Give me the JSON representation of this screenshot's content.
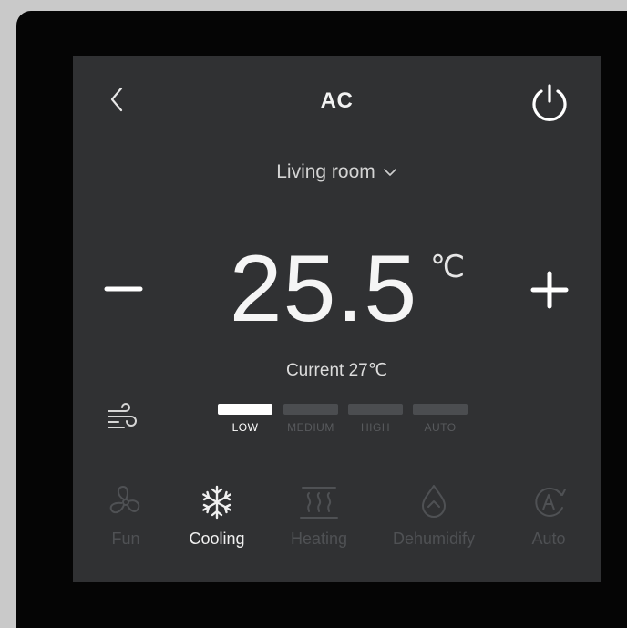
{
  "header": {
    "title": "AC"
  },
  "room": {
    "name": "Living room"
  },
  "temperature": {
    "setpoint": "25.5",
    "unit": "℃",
    "current": "Current 27℃"
  },
  "fan_speed": {
    "selected": "LOW",
    "options": [
      {
        "label": "LOW",
        "active": true
      },
      {
        "label": "MEDIUM",
        "active": false
      },
      {
        "label": "HIGH",
        "active": false
      },
      {
        "label": "AUTO",
        "active": false
      }
    ]
  },
  "modes": {
    "selected": "Cooling",
    "items": [
      {
        "label": "Fun",
        "icon": "fan-icon",
        "active": false
      },
      {
        "label": "Cooling",
        "icon": "snowflake-icon",
        "active": true
      },
      {
        "label": "Heating",
        "icon": "heating-icon",
        "active": false
      },
      {
        "label": "Dehumidify",
        "icon": "droplet-icon",
        "active": false
      },
      {
        "label": "Auto",
        "icon": "auto-icon",
        "active": false
      }
    ]
  },
  "colors": {
    "screen_bg": "#303133",
    "bezel": "#050505",
    "active": "#ffffff",
    "inactive": "#4b4d50"
  }
}
